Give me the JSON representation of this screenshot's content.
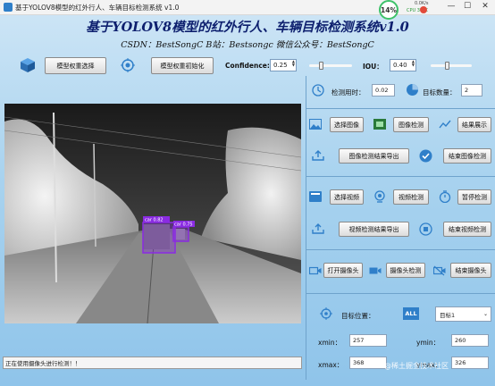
{
  "window": {
    "title": "基于YOLOV8模型的红外行人、车辆目标检测系统 v1.0",
    "perf_percent": "14%",
    "net_up": "0.0K/s",
    "net_down": "0.0K/s",
    "cpu": "CPU 37°C"
  },
  "header": {
    "title": "基于YOLOV8模型的红外行人、车辆目标检测系统v1.0",
    "subtitle": "CSDN：BestSongC   B站：Bestsongc   微信公众号：BestSongC"
  },
  "model": {
    "select_label": "模型权重选择",
    "init_label": "模型权重初始化",
    "confidence_label": "Confidence:",
    "confidence_value": "0.25",
    "confidence_level": 0.25,
    "iou_label": "IOU：",
    "iou_value": "0.40",
    "iou_level": 0.4
  },
  "stats": {
    "time_label": "检测用时：",
    "time_value": "0.02",
    "count_label": "目标数量：",
    "count_value": "2"
  },
  "image_row": {
    "select_label": "选择图像",
    "detect_label": "图像检测",
    "show_label": "结果展示",
    "export_label": "图像检测结果导出",
    "end_label": "结束图像检测"
  },
  "video_row": {
    "select_label": "选择视频",
    "detect_label": "视频检测",
    "pause_label": "暂停检测",
    "export_label": "视频检测结果导出",
    "end_label": "结束视频检测"
  },
  "camera_row": {
    "open_label": "打开摄像头",
    "detect_label": "摄像头检测",
    "end_label": "结束摄像头"
  },
  "target": {
    "position_label": "目标位置：",
    "all_badge": "ALL",
    "selected": "目标1",
    "xmin_label": "xmin：",
    "xmin_value": "257",
    "ymin_label": "ymin：",
    "ymin_value": "260",
    "xmax_label": "xmax：",
    "xmax_value": "368",
    "ymax_label": "ymax：",
    "ymax_value": "326"
  },
  "detections": [
    {
      "label": "car 0.82"
    },
    {
      "label": "car 0.75"
    }
  ],
  "status": {
    "text": "正在使用摄像头进行检测！！"
  },
  "watermark": "@稀土掘金技术社区",
  "colors": {
    "title": "#0d1f6e",
    "accent": "#2f7fc9",
    "box": "#8a2be2"
  }
}
